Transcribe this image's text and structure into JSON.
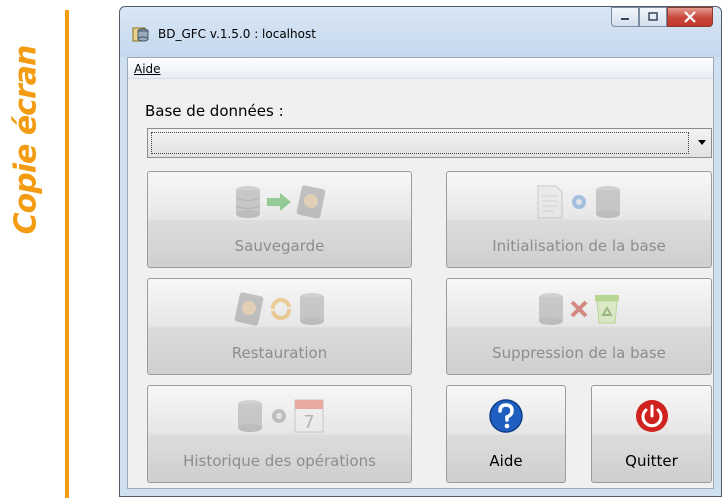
{
  "caption": "Copie écran",
  "window": {
    "title": "BD_GFC v.1.5.0 : localhost"
  },
  "menu": {
    "aide": "Aide"
  },
  "database": {
    "label": "Base de données :",
    "selected": ""
  },
  "buttons": {
    "sauvegarde": "Sauvegarde",
    "initialisation": "Initialisation de la base",
    "restauration": "Restauration",
    "suppression": "Suppression de la base",
    "historique": "Historique des opérations",
    "aide": "Aide",
    "quitter": "Quitter"
  },
  "icons": {
    "calendar_day": "7"
  },
  "colors": {
    "accent": "#f39c12",
    "close": "#c0392b",
    "help": "#1f5fbf",
    "quit": "#d0231f"
  }
}
